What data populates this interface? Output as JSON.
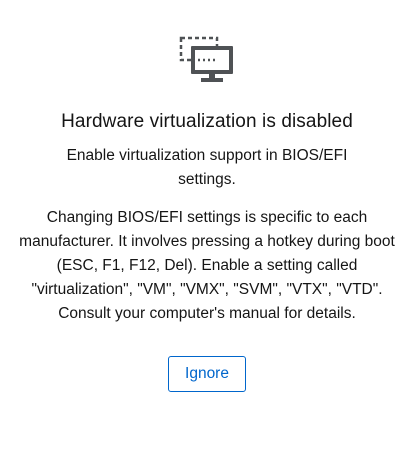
{
  "icon": {
    "name": "virtualization-monitor-icon",
    "color": "#4f5255"
  },
  "title": "Hardware virtualization is disabled",
  "subtitle": "Enable virtualization support in BIOS/EFI settings.",
  "details": "Changing BIOS/EFI settings is specific to each manufacturer. It involves pressing a hotkey during boot (ESC, F1, F12, Del). Enable a setting called \"virtualization\", \"VM\", \"VMX\", \"SVM\", \"VTX\", \"VTD\". Consult your computer's manual for details.",
  "actions": {
    "ignore_label": "Ignore"
  },
  "colors": {
    "accent": "#0066cc",
    "text": "#151515"
  }
}
